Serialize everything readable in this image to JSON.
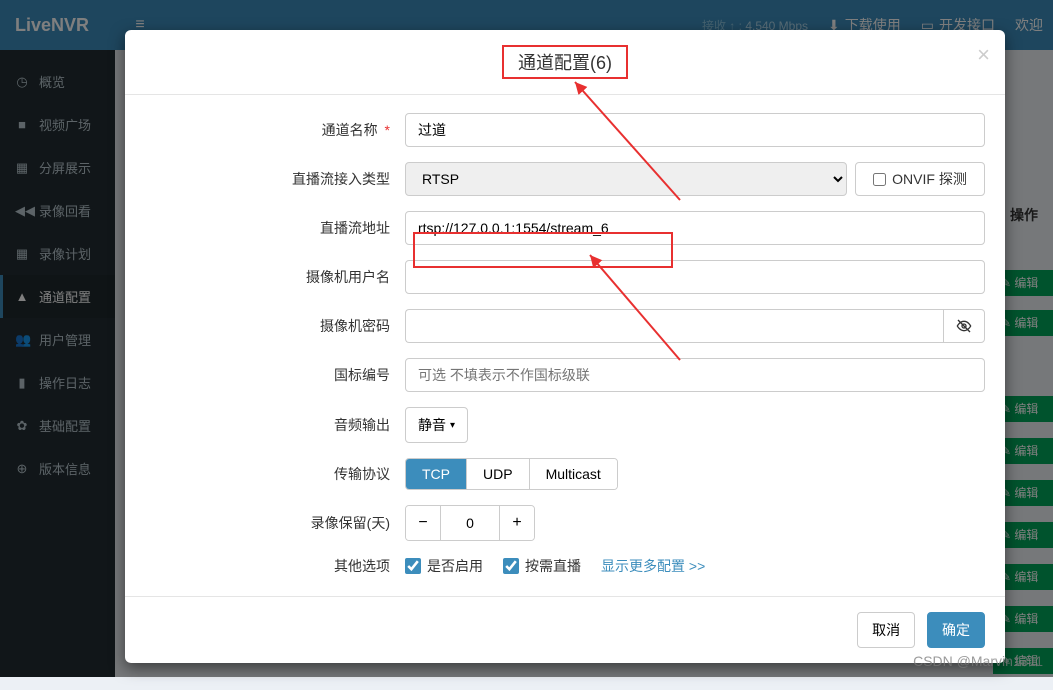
{
  "header": {
    "app_name": "LiveNVR",
    "stat": {
      "label": "接收 ↑ :",
      "value": "4.540 Mbps"
    },
    "download_label": "下载使用",
    "dev_api_label": "开发接口",
    "welcome_label": "欢迎"
  },
  "sidebar": {
    "items": [
      {
        "icon": "dashboard-icon",
        "glyph": "◷",
        "label": "概览"
      },
      {
        "icon": "video-icon",
        "glyph": "■",
        "label": "视频广场"
      },
      {
        "icon": "grid-icon",
        "glyph": "▦",
        "label": "分屏展示"
      },
      {
        "icon": "playback-icon",
        "glyph": "◀◀",
        "label": "录像回看"
      },
      {
        "icon": "plan-icon",
        "glyph": "▦",
        "label": "录像计划"
      },
      {
        "icon": "channel-icon",
        "glyph": "▲",
        "label": "通道配置"
      },
      {
        "icon": "user-mgmt-icon",
        "glyph": "👥",
        "label": "用户管理"
      },
      {
        "icon": "log-icon",
        "glyph": "▮",
        "label": "操作日志"
      },
      {
        "icon": "settings-icon",
        "glyph": "✿",
        "label": "基础配置"
      },
      {
        "icon": "version-icon",
        "glyph": "⊕",
        "label": "版本信息"
      }
    ],
    "active_index": 5
  },
  "background": {
    "op_header": "操作",
    "edit_label": "编辑"
  },
  "modal": {
    "title": "通道配置(6)",
    "labels": {
      "channel_name": "通道名称",
      "stream_type": "直播流接入类型",
      "stream_addr": "直播流地址",
      "cam_user": "摄像机用户名",
      "cam_pass": "摄像机密码",
      "gb_code": "国标编号",
      "audio_out": "音频输出",
      "transport": "传输协议",
      "record_retain": "录像保留(天)",
      "other_opts": "其他选项"
    },
    "values": {
      "channel_name": "过道",
      "stream_type": "RTSP",
      "onvif_probe": "ONVIF 探测",
      "stream_addr": "rtsp://127.0.0.1:1554/stream_6",
      "cam_user": "",
      "cam_pass": "",
      "gb_code_placeholder": "可选 不填表示不作国标级联",
      "audio_out": "静音",
      "transport_opts": [
        "TCP",
        "UDP",
        "Multicast"
      ],
      "transport_active": 0,
      "record_retain": "0",
      "enable_label": "是否启用",
      "ondemand_label": "按需直播",
      "show_more": "显示更多配置 >>"
    },
    "footer": {
      "cancel": "取消",
      "ok": "确定"
    }
  },
  "watermark": "CSDN @Marvin1311"
}
